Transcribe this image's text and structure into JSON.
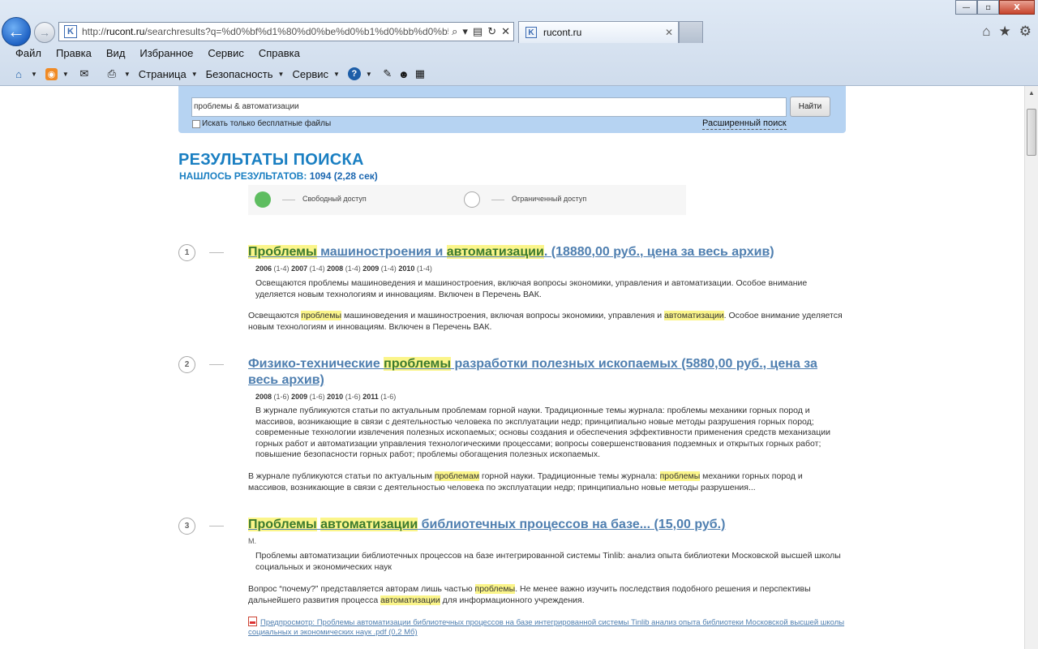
{
  "browser": {
    "window_buttons": {
      "minimize": "—",
      "maximize": "▫",
      "close": "X"
    },
    "address_url_prefix": "http://",
    "address_url_host": "rucont.ru",
    "address_url_rest": "/searchresults?q=%d0%bf%d1%80%d0%be%d0%b1%d0%bb%d0%b5",
    "tab_title": "rucont.ru",
    "menu": [
      "Файл",
      "Правка",
      "Вид",
      "Избранное",
      "Сервис",
      "Справка"
    ],
    "commands": {
      "page": "Страница",
      "safety": "Безопасность",
      "service": "Сервис"
    }
  },
  "search": {
    "query": "проблемы & автоматизации",
    "button_label": "Найти",
    "free_only_label": "Искать только бесплатные файлы",
    "advanced_label": "Расширенный поиск"
  },
  "results": {
    "heading": "РЕЗУЛЬТАТЫ ПОИСКА",
    "count_label": "НАШЛОСЬ РЕЗУЛЬТАТОВ:",
    "count_value": "1094 (2,28 сек)",
    "legend": {
      "free": "Свободный доступ",
      "restricted": "Ограниченный доступ"
    }
  },
  "items": [
    {
      "num": "1",
      "title_parts": [
        "Проблемы",
        " машиностроения и ",
        "автоматизации",
        ". (18880,00 руб., цена за весь архив)"
      ],
      "years": [
        [
          "2006",
          "(1-4)"
        ],
        [
          "2007",
          "(1-4)"
        ],
        [
          "2008",
          "(1-4)"
        ],
        [
          "2009",
          "(1-4)"
        ],
        [
          "2010",
          "(1-4)"
        ]
      ],
      "desc": "Освещаются проблемы машиноведения и машиностроения, включая вопросы экономики, управления и автоматизации. Особое внимание уделяется новым технологиям и инновациям. Включен в Перечень ВАК.",
      "snippet_parts": [
        "Освещаются ",
        "проблемы",
        " машиноведения и машиностроения, включая вопросы экономики, управления и ",
        "автоматизации",
        ". Особое внимание уделяется новым технологиям и инновациям. Включен в Перечень ВАК."
      ]
    },
    {
      "num": "2",
      "title_parts": [
        "Физико-технические ",
        "проблемы",
        " разработки полезных ископаемых (5880,00 руб., цена за весь архив)"
      ],
      "years": [
        [
          "2008",
          "(1-6)"
        ],
        [
          "2009",
          "(1-6)"
        ],
        [
          "2010",
          "(1-6)"
        ],
        [
          "2011",
          "(1-6)"
        ]
      ],
      "desc": "В журнале публикуются статьи по актуальным проблемам горной науки. Традиционные темы журнала: проблемы механики горных пород и массивов, возникающие в связи с деятельностью человека по эксплуатации недр; принципиально новые методы разрушения горных пород; современные технологии извлечения полезных ископаемых; основы создания и обеспечения эффективности применения средств механизации горных работ и автоматизации управления технологическими процессами; вопросы совершенствования подземных и открытых горных работ; повышение безопасности горных работ; проблемы обогащения полезных ископаемых.",
      "snippet_parts": [
        "В журнале публикуются статьи по актуальным ",
        "проблемам",
        " горной науки. Традиционные темы журнала: ",
        "проблемы",
        " механики горных пород и массивов, возникающие в связи с деятельностью человека по эксплуатации недр; принципиально новые методы разрушения..."
      ]
    },
    {
      "num": "3",
      "title_parts": [
        "Проблемы",
        " ",
        "автоматизации",
        " библиотечных процессов на базе... (15,00 руб.)"
      ],
      "author": "М.",
      "desc": "Проблемы автоматизации библиотечных процессов на базе интегрированной системы Tinlib: анализ опыта библиотеки Московской высшей школы социальных и экономических наук",
      "snippet_parts": [
        "Вопрос “почему?” представляется авторам лишь частью ",
        "проблемы",
        ". Не менее важно изучить последствия подобного решения и перспективы дальнейшего развития процесса ",
        "автоматизации",
        " для информационного учреждения."
      ],
      "pdf_link": "Предпросмотр: Проблемы автоматизации библиотечных процессов на базе интегрированной системы Tinlib анализ опыта библиотеки Московской высшей школы социальных и экономических наук .pdf (0,2 Мб)"
    }
  ]
}
